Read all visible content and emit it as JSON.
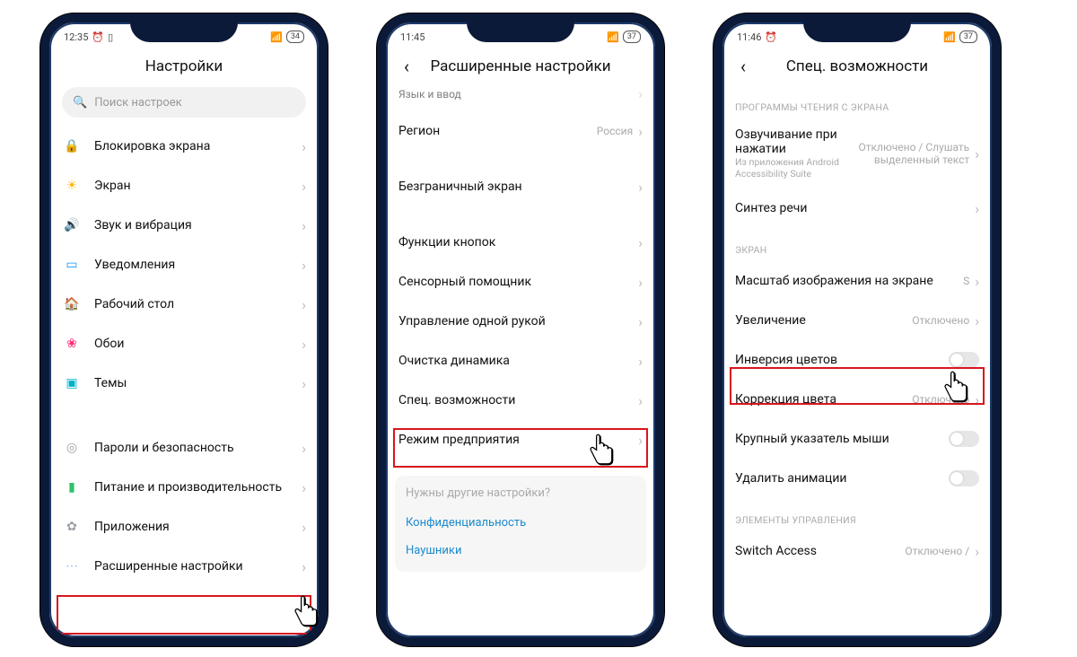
{
  "phone1": {
    "time": "12:35",
    "battery": "34",
    "title": "Настройки",
    "searchPlaceholder": "Поиск настроек",
    "rows": [
      {
        "icon": "🔒",
        "bg": "#ff6b2d",
        "label": "Блокировка экрана"
      },
      {
        "icon": "☀",
        "bg": "#ffb300",
        "label": "Экран"
      },
      {
        "icon": "🔊",
        "bg": "#1dc24c",
        "label": "Звук и вибрация"
      },
      {
        "icon": "▭",
        "bg": "#1296ff",
        "label": "Уведомления"
      },
      {
        "icon": "🏠",
        "bg": "#7b3ff2",
        "label": "Рабочий стол"
      },
      {
        "icon": "❀",
        "bg": "#ff2d7a",
        "label": "Обои"
      },
      {
        "icon": "▣",
        "bg": "#00b3c6",
        "label": "Темы"
      }
    ],
    "rows2": [
      {
        "icon": "◎",
        "bg": "#9aa0a6",
        "label": "Пароли и безопасность"
      },
      {
        "icon": "▮",
        "bg": "#2dc26b",
        "label": "Питание и производительность"
      },
      {
        "icon": "✿",
        "bg": "#9aa0a6",
        "label": "Приложения"
      },
      {
        "icon": "⋯",
        "bg": "#8fb4ff",
        "label": "Расширенные настройки"
      }
    ]
  },
  "phone2": {
    "time": "11:45",
    "battery": "37",
    "title": "Расширенные настройки",
    "topcut": "Язык и ввод",
    "rows": [
      {
        "label": "Регион",
        "val": "Россия"
      },
      {
        "label": "Безграничный экран"
      },
      {
        "label": "Функции кнопок"
      },
      {
        "label": "Сенсорный помощник"
      },
      {
        "label": "Управление одной рукой"
      },
      {
        "label": "Очистка динамика"
      },
      {
        "label": "Спец. возможности"
      },
      {
        "label": "Режим предприятия"
      }
    ],
    "footerTitle": "Нужны другие настройки?",
    "footerLinks": [
      "Конфиденциальность",
      "Наушники"
    ]
  },
  "phone3": {
    "time": "11:46",
    "battery": "37",
    "title": "Спец. возможности",
    "section1": "ПРОГРАММЫ ЧТЕНИЯ С ЭКРАНА",
    "rows1": [
      {
        "label": "Озвучивание при нажатии",
        "sub": "Из приложения Android Accessibility Suite",
        "val": "Отключено / Слушать выделенный текст"
      },
      {
        "label": "Синтез речи"
      }
    ],
    "section2": "ЭКРАН",
    "rows2": [
      {
        "label": "Масштаб изображения на экране",
        "val": "S"
      },
      {
        "label": "Увеличение",
        "val": "Отключено"
      },
      {
        "label": "Инверсия цветов",
        "toggle": true
      },
      {
        "label": "Коррекция цвета",
        "val": "Отключено"
      },
      {
        "label": "Крупный указатель мыши",
        "toggle": true
      },
      {
        "label": "Удалить анимации",
        "toggle": true
      }
    ],
    "section3": "ЭЛЕМЕНТЫ УПРАВЛЕНИЯ",
    "rows3": [
      {
        "label": "Switch Access",
        "val": "Отключено /"
      }
    ]
  }
}
